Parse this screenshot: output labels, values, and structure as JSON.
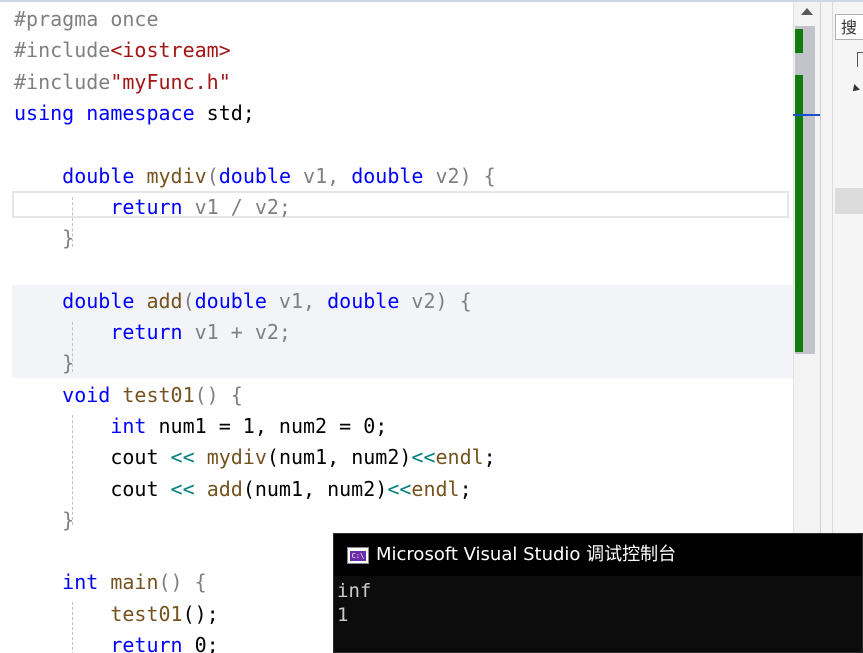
{
  "editor": {
    "lines": [
      [
        {
          "t": "#pragma once",
          "c": "pp"
        }
      ],
      [
        {
          "t": "#include",
          "c": "pp"
        },
        {
          "t": "<iostream>",
          "c": "str"
        }
      ],
      [
        {
          "t": "#include",
          "c": "pp"
        },
        {
          "t": "\"myFunc.h\"",
          "c": "str"
        }
      ],
      [
        {
          "t": "using",
          "c": "kw"
        },
        {
          "t": " "
        },
        {
          "t": "namespace",
          "c": "kw"
        },
        {
          "t": " std;"
        }
      ],
      [],
      [
        {
          "t": "    "
        },
        {
          "t": "double",
          "c": "kw"
        },
        {
          "t": " "
        },
        {
          "t": "mydiv",
          "c": "fn"
        },
        {
          "t": "(",
          "c": "par"
        },
        {
          "t": "double",
          "c": "kw"
        },
        {
          "t": " v1, ",
          "c": "par"
        },
        {
          "t": "double",
          "c": "kw"
        },
        {
          "t": " v2) {",
          "c": "par"
        }
      ],
      [
        {
          "t": "        "
        },
        {
          "t": "return",
          "c": "kw"
        },
        {
          "t": " v1 / v2;",
          "c": "par"
        }
      ],
      [
        {
          "t": "    }",
          "c": "par"
        }
      ],
      [],
      [
        {
          "t": "    "
        },
        {
          "t": "double",
          "c": "kw"
        },
        {
          "t": " "
        },
        {
          "t": "add",
          "c": "fn"
        },
        {
          "t": "(",
          "c": "par"
        },
        {
          "t": "double",
          "c": "kw"
        },
        {
          "t": " v1, ",
          "c": "par"
        },
        {
          "t": "double",
          "c": "kw"
        },
        {
          "t": " v2) {",
          "c": "par"
        }
      ],
      [
        {
          "t": "        "
        },
        {
          "t": "return",
          "c": "kw"
        },
        {
          "t": " v1 + v2;",
          "c": "par"
        }
      ],
      [
        {
          "t": "    }",
          "c": "par"
        }
      ],
      [
        {
          "t": "    "
        },
        {
          "t": "void",
          "c": "kw"
        },
        {
          "t": " "
        },
        {
          "t": "test01",
          "c": "fn"
        },
        {
          "t": "() {",
          "c": "par"
        }
      ],
      [
        {
          "t": "        "
        },
        {
          "t": "int",
          "c": "kw"
        },
        {
          "t": " num1 = 1, num2 = 0;"
        }
      ],
      [
        {
          "t": "        cout "
        },
        {
          "t": "<<",
          "c": "op"
        },
        {
          "t": " "
        },
        {
          "t": "mydiv",
          "c": "fn"
        },
        {
          "t": "(num1, num2)"
        },
        {
          "t": "<<",
          "c": "op"
        },
        {
          "t": "endl",
          "c": "fn"
        },
        {
          "t": ";"
        }
      ],
      [
        {
          "t": "        cout "
        },
        {
          "t": "<<",
          "c": "op"
        },
        {
          "t": " "
        },
        {
          "t": "add",
          "c": "fn"
        },
        {
          "t": "(num1, num2)"
        },
        {
          "t": "<<",
          "c": "op"
        },
        {
          "t": "endl",
          "c": "fn"
        },
        {
          "t": ";"
        }
      ],
      [
        {
          "t": "    }",
          "c": "par"
        }
      ],
      [],
      [
        {
          "t": "    "
        },
        {
          "t": "int",
          "c": "kw"
        },
        {
          "t": " "
        },
        {
          "t": "main",
          "c": "fn"
        },
        {
          "t": "() {",
          "c": "par"
        }
      ],
      [
        {
          "t": "        "
        },
        {
          "t": "test01",
          "c": "fn"
        },
        {
          "t": "();"
        }
      ],
      [
        {
          "t": "        "
        },
        {
          "t": "return",
          "c": "kw"
        },
        {
          "t": " 0;"
        }
      ]
    ]
  },
  "right_panel": {
    "search_label": "搜"
  },
  "console": {
    "icon_text": "C:\\",
    "title": "Microsoft Visual Studio 调试控制台",
    "output": [
      "inf",
      "1"
    ]
  },
  "colors": {
    "keyword": "#0000ff",
    "string": "#a31515",
    "preprocessor": "#808080",
    "function": "#74531f",
    "operator": "#008080",
    "change_marker": "#107c10",
    "console_bg": "#0c0c0c"
  }
}
